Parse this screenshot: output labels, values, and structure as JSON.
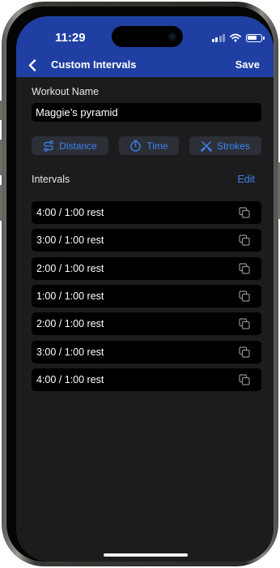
{
  "status_bar": {
    "time": "11:29"
  },
  "nav": {
    "back_icon": "chevron-left-icon",
    "title": "Custom Intervals",
    "save_label": "Save"
  },
  "workout": {
    "label": "Workout Name",
    "value": "Maggie’s pyramid"
  },
  "modes": [
    {
      "label": "Distance",
      "icon": "route-icon"
    },
    {
      "label": "Time",
      "icon": "stopwatch-icon"
    },
    {
      "label": "Strokes",
      "icon": "oars-icon"
    }
  ],
  "intervals": {
    "label": "Intervals",
    "edit_label": "Edit",
    "items": [
      {
        "label": "4:00 / 1:00 rest"
      },
      {
        "label": "3:00 / 1:00 rest"
      },
      {
        "label": "2:00 / 1:00 rest"
      },
      {
        "label": "1:00 / 1:00 rest"
      },
      {
        "label": "2:00 / 1:00 rest"
      },
      {
        "label": "3:00 / 1:00 rest"
      },
      {
        "label": "4:00 / 1:00 rest"
      }
    ]
  },
  "colors": {
    "header": "#1f3fa2",
    "accent": "#3d82f6",
    "background": "#1c1c1e",
    "field": "#000000"
  }
}
